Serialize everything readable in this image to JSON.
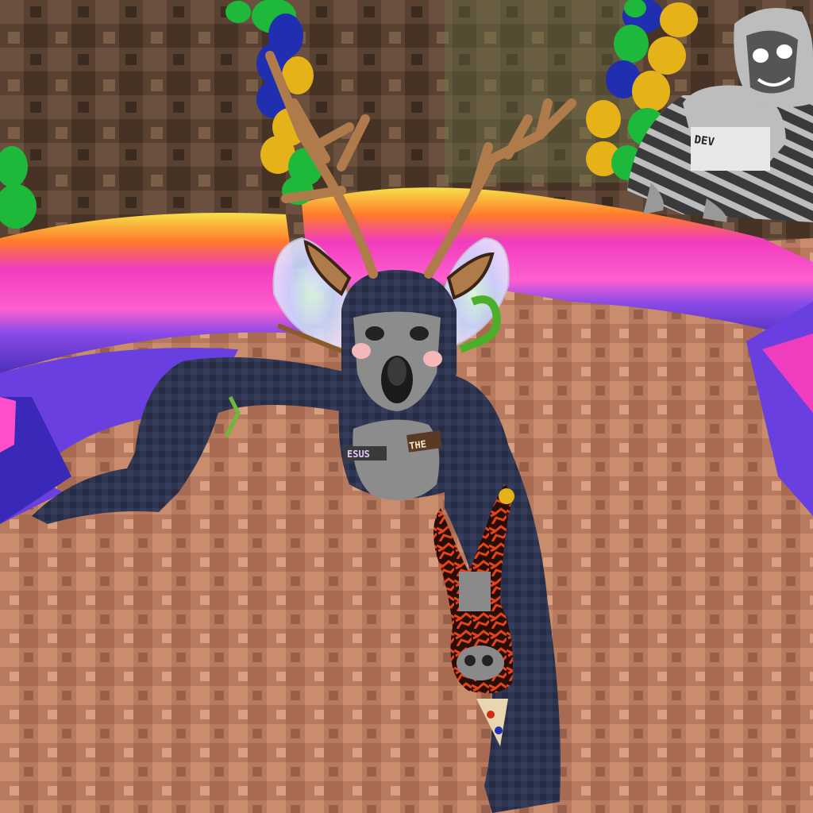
{
  "scene": {
    "type": "vr-game-screenshot",
    "setting": "cave-room-with-rainbow-inflatable-ring"
  },
  "main_gorilla": {
    "chest_badge_left": "ESUS",
    "chest_badge_right": "THE",
    "fur_color": "#2e3550",
    "face_color": "#8c8c8c",
    "cosmetics": [
      "antlers",
      "fairy-wings",
      "blush-cheeks",
      "mini-lava-gorilla-plush"
    ]
  },
  "background_gorilla": {
    "shirt_label": "DEV",
    "fur_color": "#bdbdbd"
  },
  "colors": {
    "floor": "#b87a5e",
    "cave_wall": "#5a4233",
    "ring_pink": "#f03cbe",
    "ring_purple": "#6a3fe0",
    "ring_yellow": "#f6e04a",
    "balloon_green": "#1eb83a",
    "balloon_blue": "#1f2fb0",
    "balloon_gold": "#e6b21a",
    "lava_red": "#d22a12",
    "antler": "#b07b4a"
  }
}
